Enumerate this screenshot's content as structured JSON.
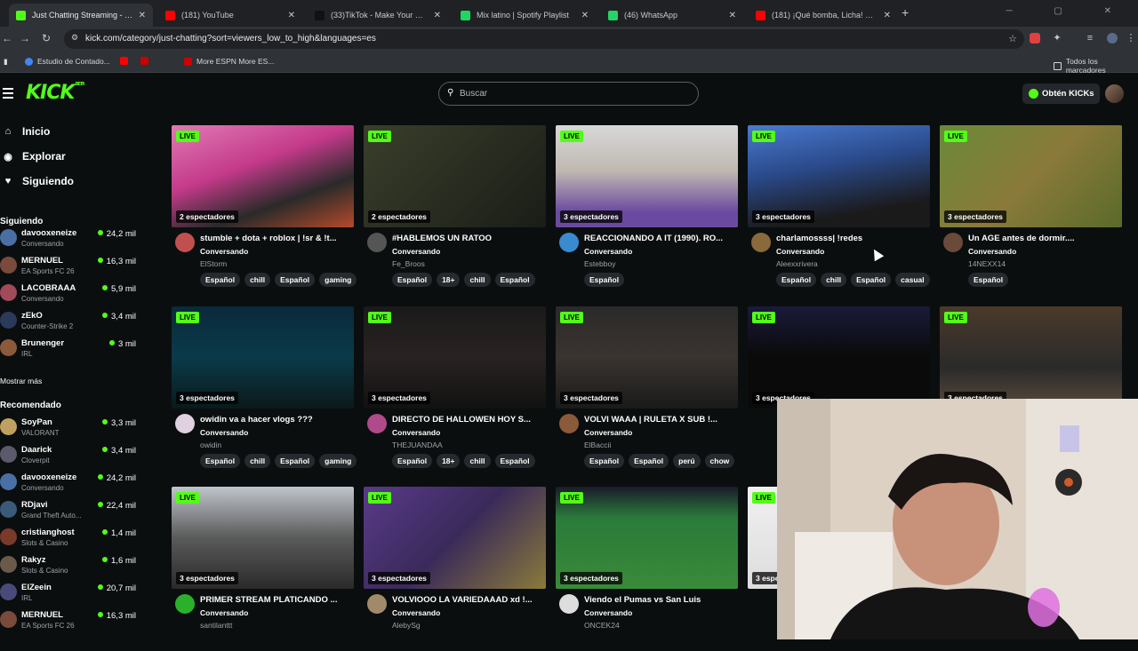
{
  "browser": {
    "tabs": [
      {
        "label": "Just Chatting Streaming - Live",
        "color": "#53fc18",
        "active": true
      },
      {
        "label": "(181) YouTube",
        "color": "#ff0000",
        "active": false
      },
      {
        "label": "(33)TikTok - Make Your Day",
        "color": "#111111",
        "active": false
      },
      {
        "label": "Mix latino | Spotify Playlist",
        "color": "#1ed760",
        "active": false
      },
      {
        "label": "(46) WhatsApp",
        "color": "#25d366",
        "active": false
      },
      {
        "label": "(181) ¡Qué bomba, Licha! El GO",
        "color": "#ff0000",
        "active": false
      }
    ],
    "new_tab": "+",
    "url": "kick.com/category/just-chatting?sort=viewers_low_to_high&languages=es",
    "bookmarks": [
      {
        "label": "Estudio de Contado...",
        "color": "#4285f4"
      },
      {
        "label": "",
        "color": "#ff0000"
      },
      {
        "label": "",
        "color": "#cc0000"
      },
      {
        "label": "More ESPN More ES...",
        "color": "#d00000"
      }
    ],
    "all_bookmarks": "Todos los marcadores"
  },
  "header": {
    "logo": "KICK",
    "logo_badge": "BETA",
    "search_placeholder": "Buscar",
    "kicks_button": "Obtén KICKs"
  },
  "sidebar": {
    "nav": [
      {
        "label": "Inicio",
        "icon": "home-icon"
      },
      {
        "label": "Explorar",
        "icon": "compass-icon"
      },
      {
        "label": "Siguiendo",
        "icon": "heart-icon"
      }
    ],
    "following_title": "Siguiendo",
    "following": [
      {
        "name": "davooxeneize",
        "category": "Conversando",
        "viewers": "24,2 mil",
        "color": "#4a6fa5"
      },
      {
        "name": "MERNUEL",
        "category": "EA Sports FC 26",
        "viewers": "16,3 mil",
        "color": "#7a4a3a"
      },
      {
        "name": "LACOBRAAA",
        "category": "Conversando",
        "viewers": "5,9 mil",
        "color": "#a04a5a"
      },
      {
        "name": "zEkO",
        "category": "Counter-Strike 2",
        "viewers": "3,4 mil",
        "color": "#2a3a5a"
      },
      {
        "name": "Brunenger",
        "category": "IRL",
        "viewers": "3 mil",
        "color": "#8a5a3a"
      }
    ],
    "show_more": "Mostrar más",
    "recommended_title": "Recomendado",
    "recommended": [
      {
        "name": "SoyPan",
        "category": "VALORANT",
        "viewers": "3,3 mil",
        "color": "#c0a060"
      },
      {
        "name": "Daarick",
        "category": "Cloverpit",
        "viewers": "3,4 mil",
        "color": "#5a5a6a"
      },
      {
        "name": "davooxeneize",
        "category": "Conversando",
        "viewers": "24,2 mil",
        "color": "#4a6fa5"
      },
      {
        "name": "RDjavi",
        "category": "Grand Theft Auto...",
        "viewers": "22,4 mil",
        "color": "#3a5a7a"
      },
      {
        "name": "cristianghost",
        "category": "Slots & Casino",
        "viewers": "1,4 mil",
        "color": "#7a3a2a"
      },
      {
        "name": "Rakyz",
        "category": "Slots & Casino",
        "viewers": "1,6 mil",
        "color": "#6a5a4a"
      },
      {
        "name": "ElZeein",
        "category": "IRL",
        "viewers": "20,7 mil",
        "color": "#4a4a7a"
      },
      {
        "name": "MERNUEL",
        "category": "EA Sports FC 26",
        "viewers": "16,3 mil",
        "color": "#7a4a3a"
      }
    ]
  },
  "live_badge": "LIVE",
  "streams": [
    {
      "title": "stumble + dota + roblox | !sr & !t...",
      "category": "Conversando",
      "user": "ElStorm",
      "viewers": "2 espectadores",
      "tags": [
        "Español",
        "chill",
        "Español",
        "gaming"
      ],
      "bg": "linear-gradient(160deg,#e07ab5,#c43a8a 40%,#2a2a2a 70%,#b54a2a)",
      "av": "#c05050"
    },
    {
      "title": "#HABLEMOS UN RATOO",
      "category": "Conversando",
      "user": "Fe_Broos",
      "viewers": "2 espectadores",
      "tags": [
        "Español",
        "18+",
        "chill",
        "Español"
      ],
      "bg": "linear-gradient(135deg,#3a3f2a,#2a2e22 50%,#1a1d16)",
      "av": "#555555"
    },
    {
      "title": "REACCIONANDO A IT (1990). RO...",
      "category": "Conversando",
      "user": "Estebboy",
      "viewers": "3 espectadores",
      "tags": [
        "Español"
      ],
      "bg": "linear-gradient(180deg,#d8d8d8,#bfb8b0 45%,#6a4aa0 85%)",
      "av": "#3a8ad0"
    },
    {
      "title": "charlamossss| !redes",
      "category": "Conversando",
      "user": "Aleexxrivera",
      "viewers": "3 espectadores",
      "tags": [
        "Español",
        "chill",
        "Español",
        "casual"
      ],
      "bg": "linear-gradient(170deg,#4a7ad0,#2a4a8a 40%,#1a1a1a 80%)",
      "av": "#8a6a3a"
    },
    {
      "title": "Un AGE antes de dormir....",
      "category": "Conversando",
      "user": "14NEXX14",
      "viewers": "3 espectadores",
      "tags": [
        "Español"
      ],
      "bg": "linear-gradient(135deg,#6a8a3a,#8a7a3a 50%,#5a6a2a)",
      "av": "#6a4a3a"
    },
    {
      "title": "owidin va a hacer vlogs ???",
      "category": "Conversando",
      "user": "owidin",
      "viewers": "3 espectadores",
      "tags": [
        "Español",
        "chill",
        "Español",
        "gaming"
      ],
      "bg": "linear-gradient(180deg,#0a2a3a,#0a3a4a 50%,#0a1a1a)",
      "av": "#e0d0e0"
    },
    {
      "title": "DIRECTO DE HALLOWEN HOY S...",
      "category": "Conversando",
      "user": "THEJUANDAA",
      "viewers": "3 espectadores",
      "tags": [
        "Español",
        "18+",
        "chill",
        "Español"
      ],
      "bg": "linear-gradient(180deg,#1a1a1a,#2a2222 50%,#111111)",
      "av": "#b04a8a"
    },
    {
      "title": "VOLVI WAAA | RULETA X SUB !...",
      "category": "Conversando",
      "user": "ElBaccii",
      "viewers": "3 espectadores",
      "tags": [
        "Español",
        "Español",
        "perú",
        "chow"
      ],
      "bg": "linear-gradient(180deg,#2a2a2a,#3a3430 50%,#1a1a1a)",
      "av": "#8a5a3a"
    },
    {
      "title": "",
      "category": "",
      "user": "",
      "viewers": "3 espectadores",
      "tags": [],
      "bg": "linear-gradient(180deg,#1a1a3a,#0a0a0a 50%,#0a0a0a)",
      "av": "#0b0e0f"
    },
    {
      "title": "",
      "category": "",
      "user": "",
      "viewers": "3 espectadores",
      "tags": [],
      "bg": "linear-gradient(180deg,#4a3a2a,#2a2a2a 60%,#5a4a3a)",
      "av": "#0b0e0f"
    },
    {
      "title": "PRIMER STREAM PLATICANDO ...",
      "category": "Conversando",
      "user": "santilanttt",
      "viewers": "3 espectadores",
      "tags": [],
      "bg": "linear-gradient(180deg,#bfc5cc,#5a5a5a 50%,#2a2a2a)",
      "av": "#2ab02a"
    },
    {
      "title": "VOLVIOOO LA VARIEDAAAD xd !...",
      "category": "Conversando",
      "user": "AlebySg",
      "viewers": "3 espectadores",
      "tags": [],
      "bg": "linear-gradient(135deg,#5a3a8a,#3a2a5a 50%,#8a7a3a)",
      "av": "#a08a6a"
    },
    {
      "title": "Viendo el Pumas vs San Luis",
      "category": "Conversando",
      "user": "ONCEK24",
      "viewers": "3 espectadores",
      "tags": [],
      "bg": "linear-gradient(180deg,#1a1a2a,#2a7a3a 30%,#3a8a3a)",
      "av": "#dddddd"
    },
    {
      "title": "",
      "category": "",
      "user": "",
      "viewers": "3 espe",
      "tags": [],
      "bg": "linear-gradient(180deg,#f0f0f0,#ddd)",
      "av": "#5a3a2a"
    }
  ]
}
